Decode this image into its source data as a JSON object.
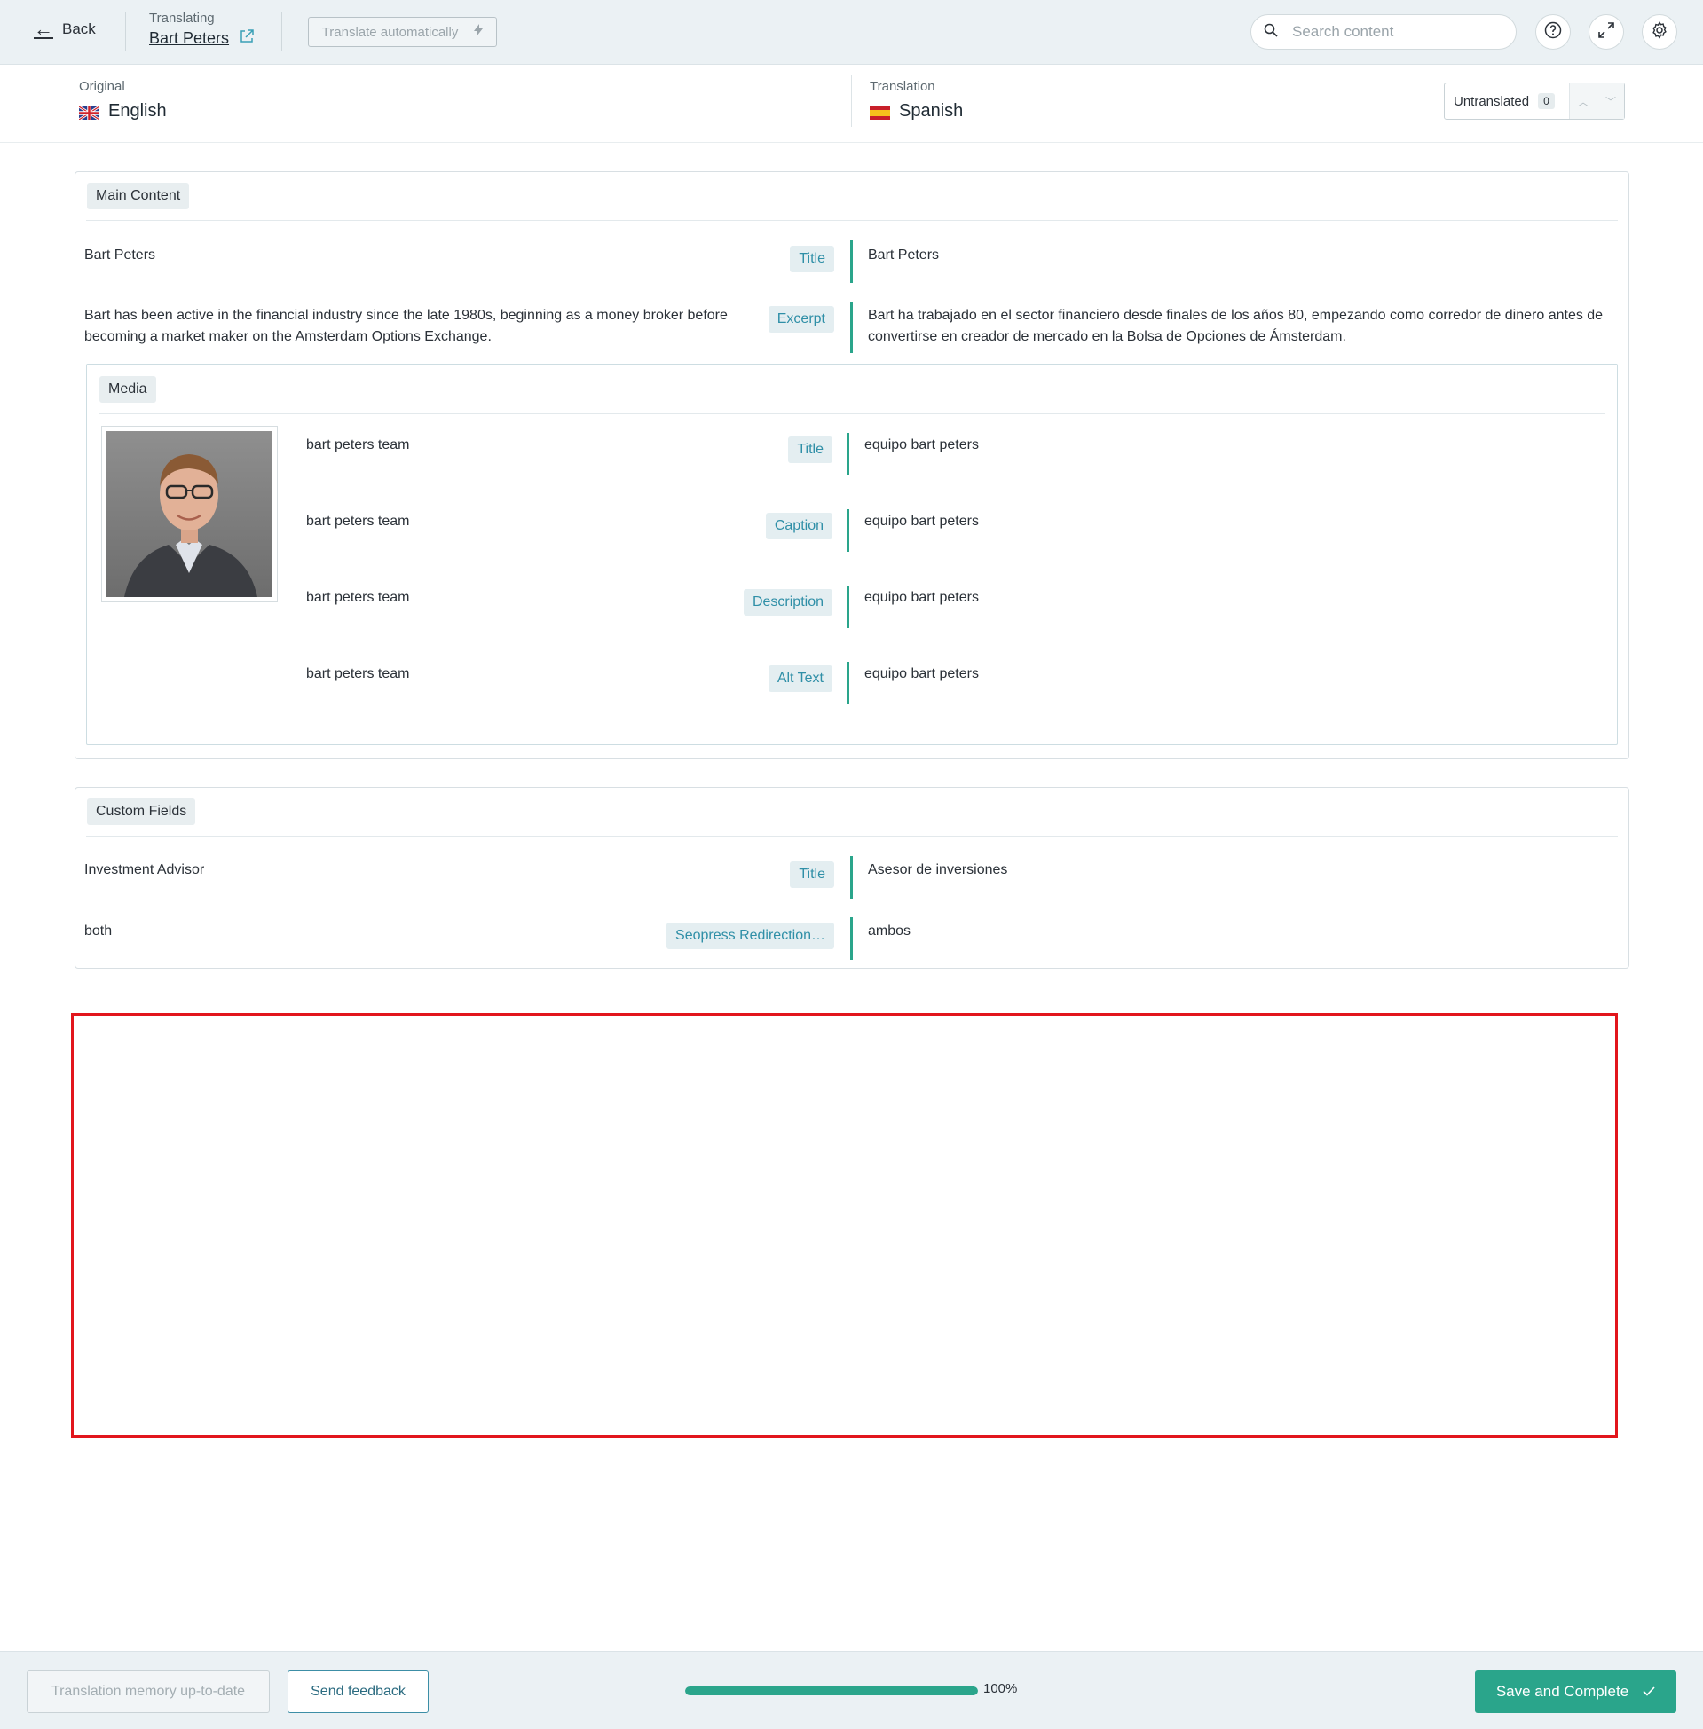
{
  "header": {
    "back_label": "Back",
    "translating_label": "Translating",
    "post_title": "Bart Peters",
    "translate_auto_label": "Translate automatically",
    "search_placeholder": "Search content"
  },
  "languages": {
    "original_label": "Original",
    "original_name": "English",
    "translation_label": "Translation",
    "translation_name": "Spanish",
    "untranslated_label": "Untranslated",
    "untranslated_count": "0"
  },
  "main_content": {
    "section_label": "Main Content",
    "rows": [
      {
        "original": "Bart Peters",
        "field": "Title",
        "translation": "Bart Peters"
      },
      {
        "original": "Bart has been active in the financial industry since the late 1980s, beginning as a money broker before becoming a market maker on the Amsterdam Options Exchange.",
        "field": "Excerpt",
        "translation": "Bart ha trabajado en el sector financiero desde finales de los años 80, empezando como corredor de dinero antes de convertirse en creador de mercado en la Bolsa de Opciones de Ámsterdam."
      }
    ]
  },
  "media": {
    "section_label": "Media",
    "rows": [
      {
        "original": "bart peters team",
        "field": "Title",
        "translation": "equipo bart peters"
      },
      {
        "original": "bart peters team",
        "field": "Caption",
        "translation": "equipo bart peters"
      },
      {
        "original": "bart peters team",
        "field": "Description",
        "translation": "equipo bart peters"
      },
      {
        "original": "bart peters team",
        "field": "Alt Text",
        "translation": "equipo bart peters"
      }
    ]
  },
  "custom_fields": {
    "section_label": "Custom Fields",
    "rows": [
      {
        "original": "Investment Advisor",
        "field": "Title",
        "translation": "Asesor de inversiones"
      },
      {
        "original": "both",
        "field": "Seopress Redirection…",
        "translation": "ambos"
      }
    ]
  },
  "footer": {
    "memory_label": "Translation memory up-to-date",
    "feedback_label": "Send feedback",
    "progress_percent": 100,
    "progress_text": "100%",
    "save_label": "Save and Complete"
  },
  "colors": {
    "accent_green": "#2aa58b",
    "tag_blue": "#2f8fa7",
    "highlight_red": "#e2161c"
  }
}
